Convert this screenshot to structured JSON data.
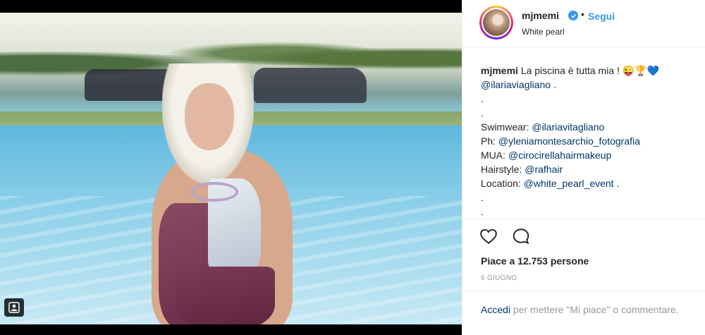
{
  "post": {
    "username": "mjmemi",
    "follow_label": "Segui",
    "separator": "•",
    "location": "White pearl"
  },
  "caption": {
    "username": "mjmemi",
    "text": "La piscina è tutta mia !",
    "emojis": "😜🏆💙",
    "mention_1": "@ilariaviagliano",
    "mention_1_suffix": ".",
    "dot_1": ".",
    "dot_2": ".",
    "lines": [
      {
        "label": "Swimwear:",
        "handle": "@ilariavitagliano",
        "suffix": ""
      },
      {
        "label": "Ph:",
        "handle": "@yleniamontesarchio_fotografia",
        "suffix": ""
      },
      {
        "label": "MUA:",
        "handle": "@cirocirellahairmakeup",
        "suffix": ""
      },
      {
        "label": "Hairstyle:",
        "handle": "@rafhair",
        "suffix": ""
      },
      {
        "label": "Location:",
        "handle": "@white_pearl_event",
        "suffix": " ."
      }
    ],
    "dot_3": ".",
    "dot_4": "."
  },
  "stats": {
    "likes": "Piace a 12.753 persone",
    "date": "6 GIUGNO"
  },
  "login": {
    "link": "Accedi",
    "rest": "per mettere \"Mi piace\" o commentare."
  },
  "icons": {
    "tag": "person-tag-icon",
    "verified": "verified-badge-icon",
    "like": "heart-icon",
    "comment": "comment-bubble-icon"
  },
  "colors": {
    "link": "#003569",
    "follow": "#3897f0",
    "text": "#262626",
    "muted": "#999999"
  }
}
